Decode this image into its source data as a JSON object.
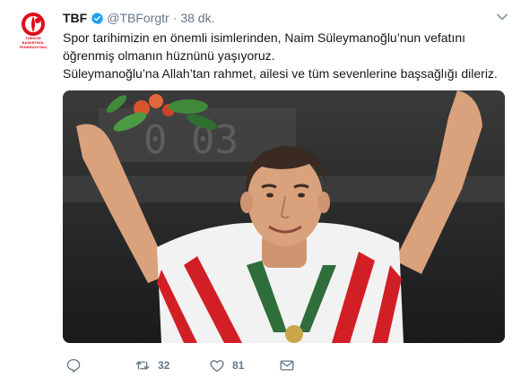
{
  "tweet": {
    "author_name": "TBF",
    "handle": "@TBForgtr",
    "separator": "·",
    "time": "38 dk.",
    "paragraphs": [
      "Spor tarihimizin en önemli isimlerinden, Naim Süleymanoğlu’nun vefatını öğrenmiş olmanın hüznünü yaşıyoruz.",
      "Süleymanoğlu’na Allah’tan rahmet, ailesi ve tüm sevenlerine başsağlığı dileriz."
    ],
    "avatar_caption": "TÜRKİYE BASKETBOL FEDERASYONU"
  },
  "actions": {
    "reply_count": "",
    "retweet_count": "32",
    "like_count": "81"
  },
  "colors": {
    "brand": "#e30a17",
    "verified": "#1da1f2",
    "muted": "#657786"
  },
  "icons": [
    "chevron-down-icon",
    "verified-icon",
    "reply-icon",
    "retweet-icon",
    "like-icon",
    "direct-message-icon"
  ]
}
